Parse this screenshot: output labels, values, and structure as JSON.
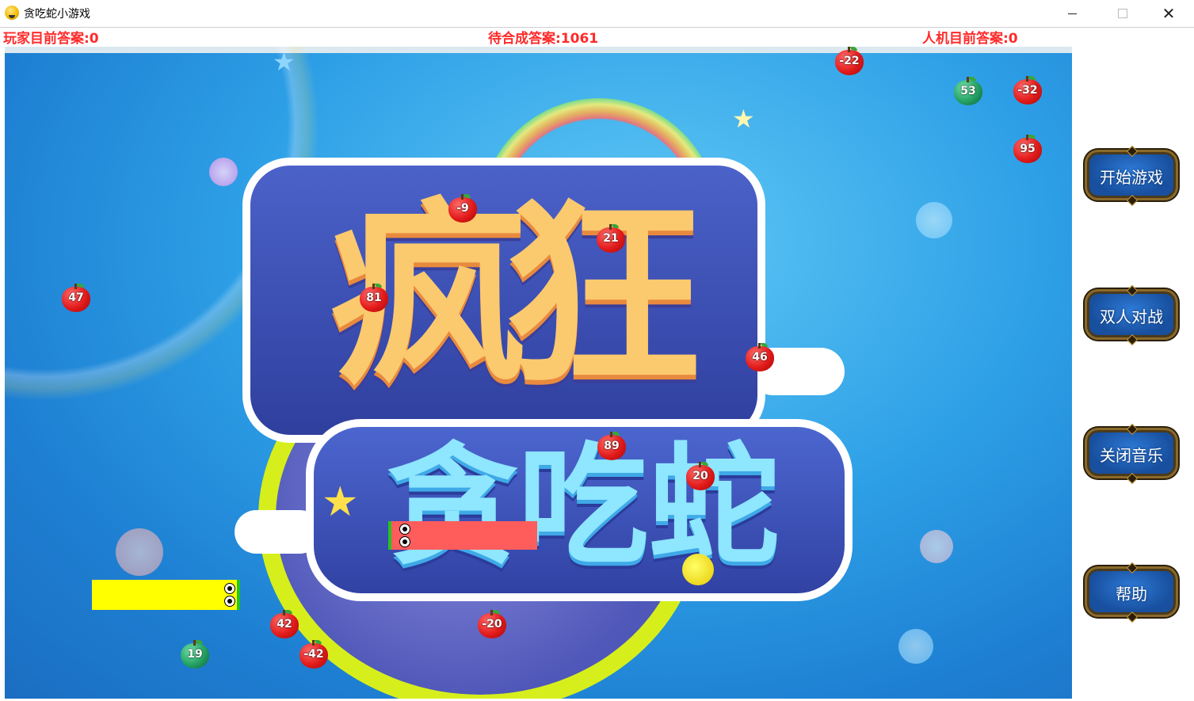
{
  "window": {
    "title": "贪吃蛇小游戏"
  },
  "scores": {
    "player": "玩家目前答案:0",
    "target": "待合成答案:1061",
    "ai": "人机目前答案:0"
  },
  "buttons": {
    "start": "开始游戏",
    "versus": "双人对战",
    "music": "关闭音乐",
    "help": "帮助"
  },
  "apples": [
    {
      "label": "-22",
      "color": "red"
    },
    {
      "label": "53",
      "color": "green"
    },
    {
      "label": "-32",
      "color": "red"
    },
    {
      "label": "95",
      "color": "red"
    },
    {
      "label": "-9",
      "color": "red"
    },
    {
      "label": "21",
      "color": "red"
    },
    {
      "label": "47",
      "color": "red"
    },
    {
      "label": "81",
      "color": "red"
    },
    {
      "label": "46",
      "color": "red"
    },
    {
      "label": "89",
      "color": "red"
    },
    {
      "label": "20",
      "color": "red"
    },
    {
      "label": "42",
      "color": "red"
    },
    {
      "label": "-42",
      "color": "red"
    },
    {
      "label": "19",
      "color": "green"
    },
    {
      "label": "-20",
      "color": "red"
    }
  ],
  "colors": {
    "score_text": "#ff2a2a",
    "player_snake": "#ffff00",
    "ai_snake": "#ff5c5c"
  }
}
